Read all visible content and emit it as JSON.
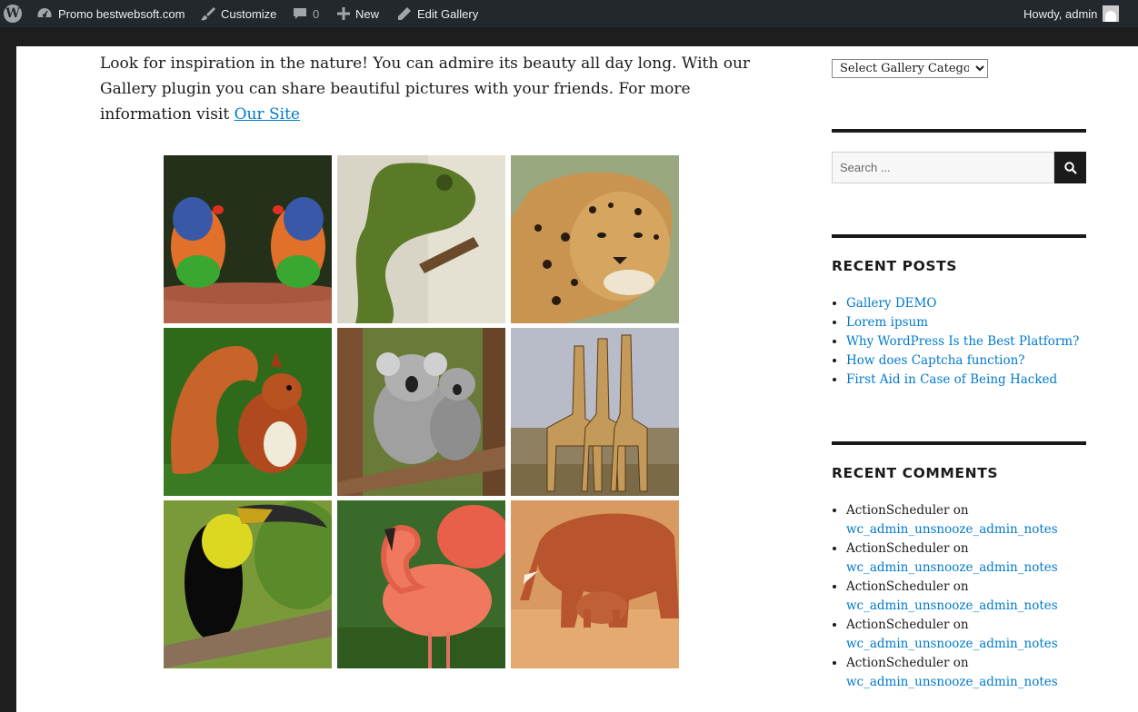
{
  "adminbar": {
    "site_name": "Promo bestwebsoft.com",
    "customize": "Customize",
    "comments_count": "0",
    "new_label": "New",
    "edit_label": "Edit Gallery",
    "greeting": "Howdy, admin"
  },
  "content": {
    "intro_text": "Look for inspiration in the nature! You can admire its beauty all day long. With our Gallery plugin you can share beautiful pictures with your friends. For more information visit ",
    "intro_link": "Our Site",
    "gallery": [
      "parrots",
      "chameleon",
      "leopard",
      "squirrel",
      "koalas",
      "giraffes",
      "toucan",
      "flamingo",
      "elephants"
    ]
  },
  "sidebar": {
    "category_select": "Select Gallery Category",
    "search_placeholder": "Search ...",
    "recent_posts_title": "RECENT POSTS",
    "recent_posts": [
      "Gallery DEMO",
      "Lorem ipsum",
      "Why WordPress Is the Best Platform?",
      "How does Captcha function?",
      "First Aid in Case of Being Hacked"
    ],
    "recent_comments_title": "RECENT COMMENTS",
    "recent_comments": [
      {
        "author": "ActionScheduler",
        "on": "on",
        "link": "wc_admin_unsnooze_admin_notes"
      },
      {
        "author": "ActionScheduler",
        "on": "on",
        "link": "wc_admin_unsnooze_admin_notes"
      },
      {
        "author": "ActionScheduler",
        "on": "on",
        "link": "wc_admin_unsnooze_admin_notes"
      },
      {
        "author": "ActionScheduler",
        "on": "on",
        "link": "wc_admin_unsnooze_admin_notes"
      },
      {
        "author": "ActionScheduler",
        "on": "on",
        "link": "wc_admin_unsnooze_admin_notes"
      }
    ]
  },
  "colors": {
    "link": "#007acc",
    "adminbar": "#23282d",
    "text": "#1a1a1a"
  }
}
